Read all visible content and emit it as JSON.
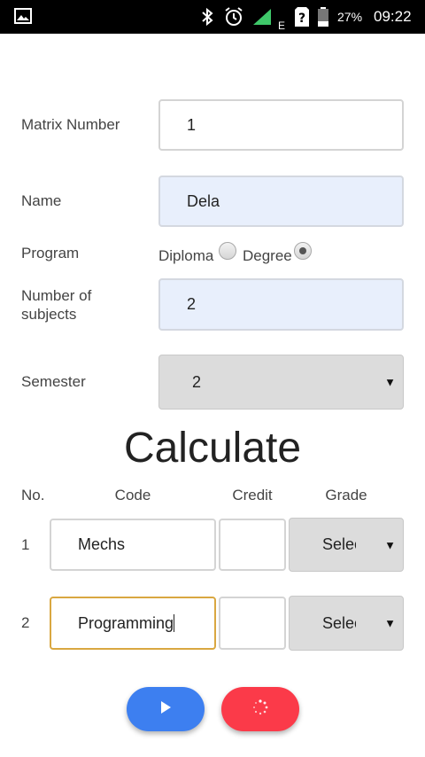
{
  "status_bar": {
    "battery_percent": "27%",
    "time": "09:22",
    "sim_label": "E",
    "icons": [
      "image-icon",
      "bluetooth-icon",
      "alarm-icon",
      "signal-icon",
      "sim-unknown-icon",
      "battery-icon"
    ]
  },
  "form": {
    "matrix_number": {
      "label": "Matrix Number",
      "value": "1"
    },
    "name": {
      "label": "Name",
      "value": "Dela"
    },
    "program": {
      "label": "Program",
      "options": [
        "Diploma",
        "Degree"
      ],
      "selected": "Degree"
    },
    "number_of_subjects": {
      "label": "Number of subjects",
      "value": "2"
    },
    "semester": {
      "label": "Semester",
      "value": "2"
    }
  },
  "calculate": {
    "title": "Calculate",
    "headers": {
      "no": "No.",
      "code": "Code",
      "credit": "Credit",
      "grade": "Grade"
    },
    "rows": [
      {
        "no": "1",
        "code": "Mechs",
        "credit": "",
        "grade": "Select"
      },
      {
        "no": "2",
        "code": "Programming",
        "credit": "",
        "grade": "Select"
      }
    ]
  },
  "actions": {
    "play": {
      "icon": "play-icon",
      "color": "#3d7ff0"
    },
    "reset": {
      "icon": "loading-icon",
      "color": "#fb3a49"
    }
  }
}
